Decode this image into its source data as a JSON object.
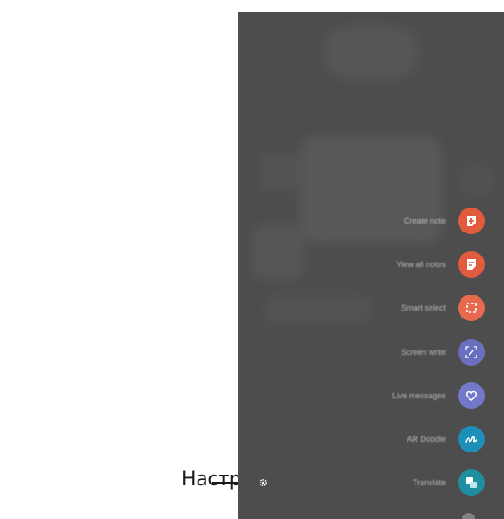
{
  "callout": {
    "label": "Настройки на S Pen"
  },
  "air_command": {
    "items": [
      {
        "label": "Create note",
        "icon": "note-plus-icon",
        "color": "#e25b3d"
      },
      {
        "label": "View all notes",
        "icon": "notes-list-icon",
        "color": "#e25b3d"
      },
      {
        "label": "Smart select",
        "icon": "smart-select-icon",
        "color": "#e86a4e"
      },
      {
        "label": "Screen write",
        "icon": "screen-write-icon",
        "color": "#6a6fc0"
      },
      {
        "label": "Live messages",
        "icon": "heart-bubble-icon",
        "color": "#7378c8"
      },
      {
        "label": "AR Doodle",
        "icon": "doodle-icon",
        "color": "#1e8fb8"
      },
      {
        "label": "Translate",
        "icon": "translate-icon",
        "color": "#1e8fa0"
      }
    ]
  },
  "colors": {
    "screen_bg": "#4d4d4d",
    "label_text": "#1a1a1a"
  }
}
